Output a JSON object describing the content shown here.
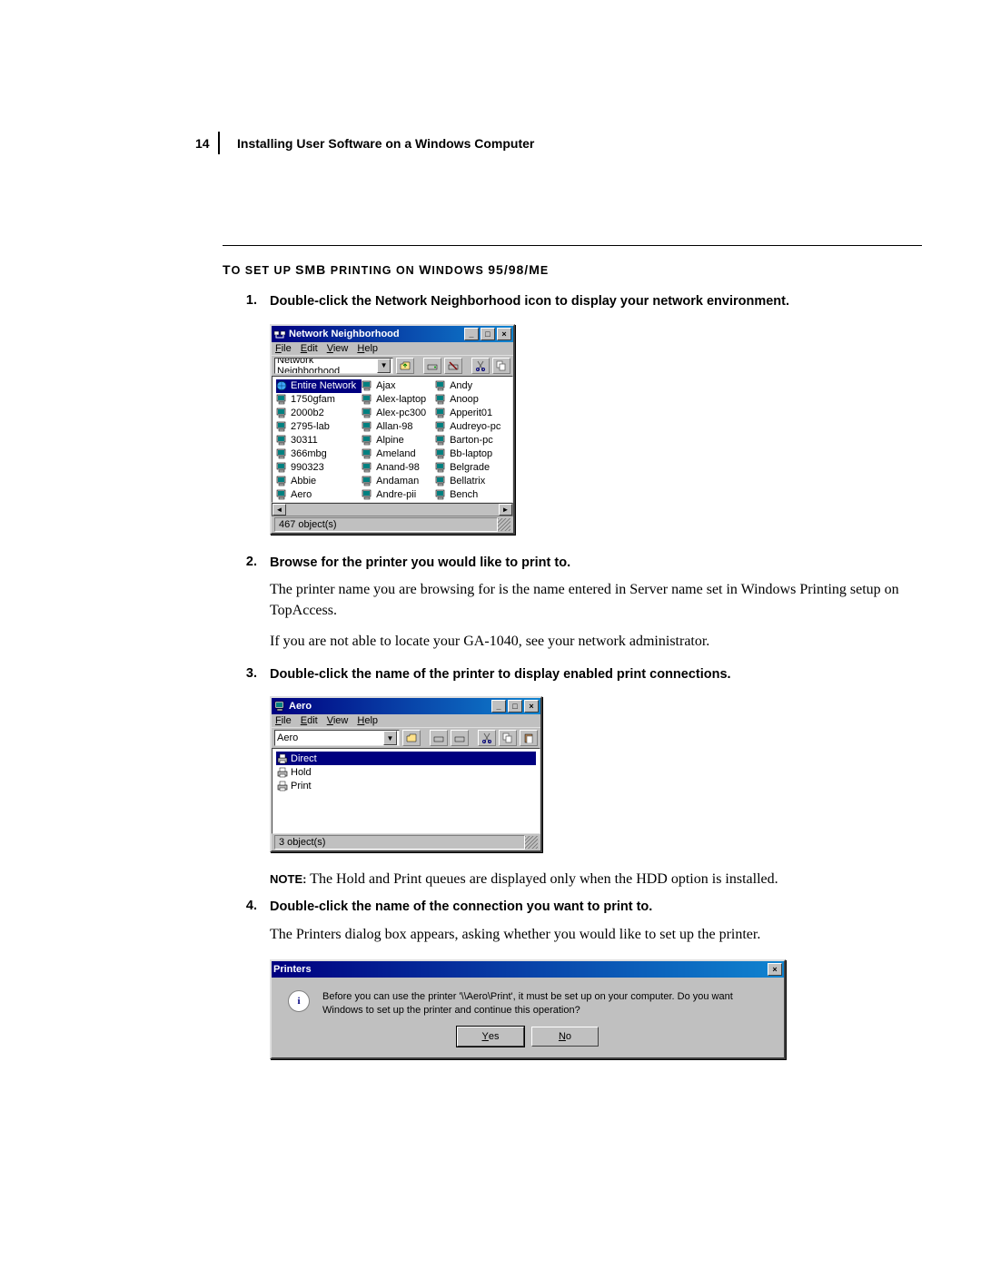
{
  "page_number": "14",
  "chapter_title": "Installing User Software on a Windows Computer",
  "section_heading": "TO SET UP SMB PRINTING ON WINDOWS 95/98/ME",
  "steps": {
    "1": {
      "num": "1.",
      "title": "Double-click the Network Neighborhood icon to display your network environment."
    },
    "2": {
      "num": "2.",
      "title": "Browse for the printer you would like to print to.",
      "p1": "The printer name you are browsing for is the name entered in Server name set in Windows Printing setup on TopAccess.",
      "p2": "If you are not able to locate your GA-1040, see your network administrator."
    },
    "3": {
      "num": "3.",
      "title": "Double-click the name of the printer to display enabled print connections."
    },
    "4": {
      "num": "4.",
      "title": "Double-click the name of the connection you want to print to.",
      "p1": "The Printers dialog box appears, asking whether you would like to set up the printer."
    }
  },
  "note": {
    "label": "NOTE:",
    "text": "The Hold and Print queues are displayed only when the HDD option is installed."
  },
  "win1": {
    "title": "Network Neighborhood",
    "address": "Network Neighborhood",
    "menu": {
      "file": "File",
      "edit": "Edit",
      "view": "View",
      "help": "Help"
    },
    "cols": [
      [
        "Entire Network",
        "1750gfam",
        "2000b2",
        "2795-lab",
        "30311",
        "366mbg",
        "990323",
        "Abbie",
        "Aero"
      ],
      [
        "Ajax",
        "Alex-laptop",
        "Alex-pc300",
        "Allan-98",
        "Alpine",
        "Ameland",
        "Anand-98",
        "Andaman",
        "Andre-pii"
      ],
      [
        "Andy",
        "Anoop",
        "Apperit01",
        "Audreyo-pc",
        "Barton-pc",
        "Bb-laptop",
        "Belgrade",
        "Bellatrix",
        "Bench"
      ]
    ],
    "status": "467 object(s)"
  },
  "win2": {
    "title": "Aero",
    "address": "Aero",
    "menu": {
      "file": "File",
      "edit": "Edit",
      "view": "View",
      "help": "Help"
    },
    "items": [
      "Direct",
      "Hold",
      "Print"
    ],
    "status": "3 object(s)"
  },
  "dlg": {
    "title": "Printers",
    "text": "Before you can use the printer '\\\\Aero\\Print', it must be set up on your computer. Do you want Windows to set up the printer and continue this operation?",
    "yes": "Yes",
    "no": "No"
  }
}
